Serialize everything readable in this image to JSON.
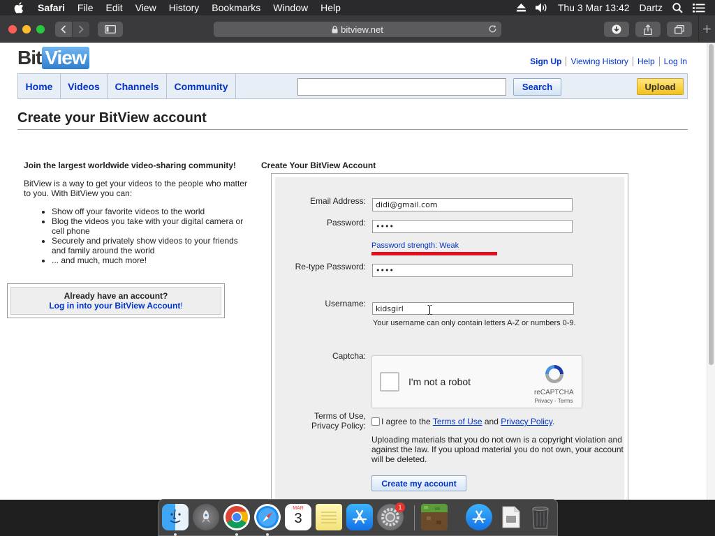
{
  "menubar": {
    "app": "Safari",
    "items": [
      "File",
      "Edit",
      "View",
      "History",
      "Bookmarks",
      "Window",
      "Help"
    ],
    "clock": "Thu 3 Mar  13:42",
    "user": "Dartz",
    "icons": [
      "apple-icon",
      "eject-icon",
      "volume-icon",
      "search-icon",
      "list-icon"
    ]
  },
  "browser": {
    "url": "bitview.net"
  },
  "site": {
    "logo_bit": "Bit",
    "logo_view": "View",
    "toplinks": [
      "Sign Up",
      "Viewing History",
      "Help",
      "Log In"
    ],
    "nav": [
      "Home",
      "Videos",
      "Channels",
      "Community"
    ],
    "search_placeholder": "",
    "search_button": "Search",
    "upload_button": "Upload",
    "page_title": "Create your BitView account"
  },
  "left": {
    "heading": "Join the largest worldwide video-sharing community!",
    "intro": "BitView is a way to get your videos to the people who matter to you. With BitView you can:",
    "bullets": [
      "Show off your favorite videos to the world",
      "Blog the videos you take with your digital camera or cell phone",
      "Securely and privately show videos to your friends and family around the world",
      "... and much, much more!"
    ],
    "account_q": "Already have an account?",
    "account_link": "Log in into your BitView Account",
    "account_end": "!"
  },
  "form": {
    "heading": "Create Your BitView Account",
    "email_label": "Email Address:",
    "email_value": "didi@gmail.com",
    "password_label": "Password:",
    "password_value": "••••",
    "strength_text": "Password strength: Weak",
    "strength_color": "#e0101f",
    "retype_label": "Re-type Password:",
    "retype_value": "••••",
    "username_label": "Username:",
    "username_value": "kidsgirl",
    "username_hint": "Your username can only contain letters A-Z or numbers 0-9.",
    "captcha_label": "Captcha:",
    "captcha_text": "I'm not a robot",
    "captcha_brand": "reCAPTCHA",
    "captcha_terms": "Privacy - Terms",
    "terms_label_1": "Terms of Use,",
    "terms_label_2": "Privacy Policy:",
    "agree_prefix": "I agree to the ",
    "terms_link": "Terms of Use",
    "agree_and": " and ",
    "privacy_link": "Privacy Policy",
    "agree_end": ".",
    "warning": "Uploading materials that you do not own is a copyright violation and against the law. If you upload material you do not own, your account will be deleted.",
    "create_button": "Create my account"
  },
  "dock": {
    "calendar_month": "MAR",
    "calendar_day": "3",
    "badge_count": "1",
    "apps": [
      "finder-icon",
      "launchpad-icon",
      "chrome-icon",
      "safari-icon",
      "calendar-icon",
      "notes-icon",
      "app-store-icon",
      "system-preferences-icon",
      "minecraft-icon",
      "app-store-folder-icon",
      "document-icon",
      "trash-icon"
    ]
  }
}
